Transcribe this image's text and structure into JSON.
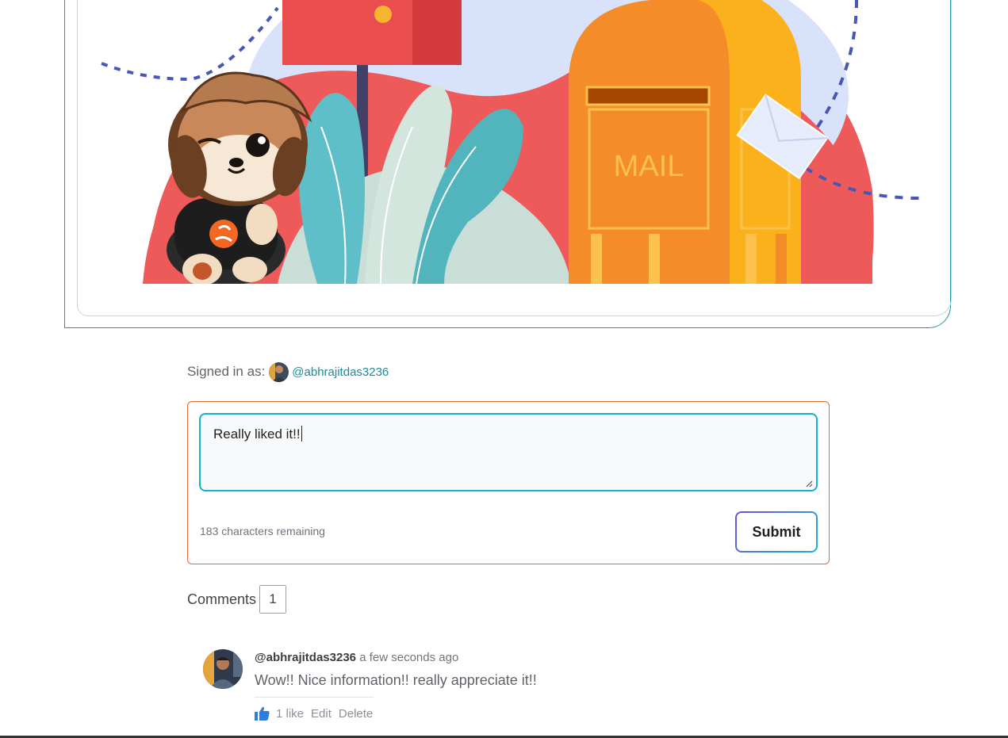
{
  "hero": {
    "mailbox_label": "MAIL"
  },
  "signed_in": {
    "label": "Signed in as:",
    "username": "@abhrajitdas3236"
  },
  "comment_form": {
    "textarea_value": "Really liked it!!",
    "chars_remaining": "183 characters remaining",
    "submit_label": "Submit"
  },
  "comments": {
    "label": "Comments",
    "count": "1",
    "items": [
      {
        "author": "@abhrajitdas3236",
        "time": "a few seconds ago",
        "text": "Wow!! Nice information!! really appreciate it!!",
        "likes": "1 like",
        "edit_label": "Edit",
        "delete_label": "Delete"
      }
    ]
  },
  "colors": {
    "accent": "#1a9ba0",
    "form_border": "#e16a38",
    "textarea_border": "#14b2cc",
    "like_icon": "#2f7de1"
  },
  "icons": {
    "like": "thumbs-up-icon",
    "resize": "resize-handle-icon"
  }
}
